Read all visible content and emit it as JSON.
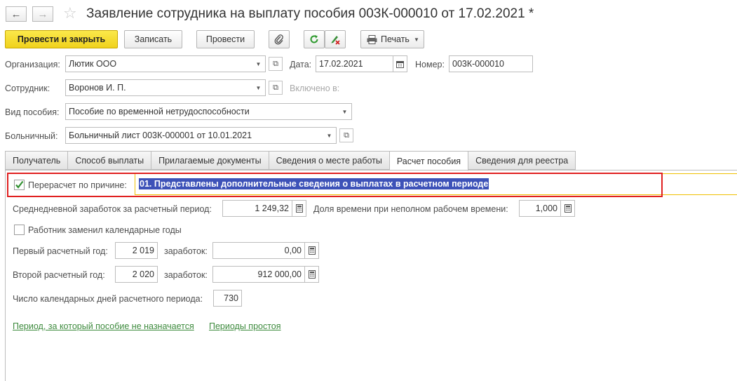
{
  "window": {
    "title": "Заявление сотрудника на выплату пособия 003К-000010 от 17.02.2021 *"
  },
  "toolbar": {
    "post_close": "Провести и закрыть",
    "save": "Записать",
    "post": "Провести",
    "print": "Печать"
  },
  "header": {
    "org_label": "Организация:",
    "org_value": "Лютик ООО",
    "date_label": "Дата:",
    "date_value": "17.02.2021",
    "number_label": "Номер:",
    "number_value": "003К-000010",
    "employee_label": "Сотрудник:",
    "employee_value": "Воронов И. П.",
    "included_label": "Включено в:",
    "benefit_label": "Вид пособия:",
    "benefit_value": "Пособие по временной нетрудоспособности",
    "sick_label": "Больничный:",
    "sick_value": "Больничный лист 003К-000001 от 10.01.2021"
  },
  "tabs": [
    {
      "label": "Получатель"
    },
    {
      "label": "Способ выплаты"
    },
    {
      "label": "Прилагаемые документы"
    },
    {
      "label": "Сведения о месте работы"
    },
    {
      "label": "Расчет пособия"
    },
    {
      "label": "Сведения для реестра"
    }
  ],
  "calc": {
    "recalc_label": "Перерасчет по причине:",
    "recalc_checked": true,
    "recalc_value": "01. Представлены дополнительные сведения о выплатах в расчетном периоде",
    "avg_label": "Среднедневной заработок за расчетный период:",
    "avg_value": "1 249,32",
    "share_label": "Доля времени при неполном рабочем времени:",
    "share_value": "1,000",
    "replaced_label": "Работник заменил календарные годы",
    "replaced_checked": false,
    "year1_label": "Первый расчетный год:",
    "year1_value": "2 019",
    "earn1_label": "заработок:",
    "earn1_value": "0,00",
    "year2_label": "Второй расчетный год:",
    "year2_value": "2 020",
    "earn2_label": "заработок:",
    "earn2_value": "912 000,00",
    "days_label": "Число календарных дней расчетного периода:",
    "days_value": "730",
    "link_not_assigned": "Период, за который пособие не назначается",
    "link_idle": "Периоды простоя"
  },
  "colors": {
    "primary_button": "#f0d21d",
    "highlight_bg": "#3d52b8",
    "red_frame": "#e02020",
    "link": "#3e8b3e",
    "active_field_border": "#f0c000"
  },
  "icons": [
    "back-arrow-icon",
    "forward-arrow-icon",
    "star-icon",
    "paperclip-icon",
    "refresh-icon",
    "edit-clear-icon",
    "printer-icon",
    "calendar-icon",
    "calculator-icon",
    "open-form-icon",
    "checkmark-icon"
  ]
}
